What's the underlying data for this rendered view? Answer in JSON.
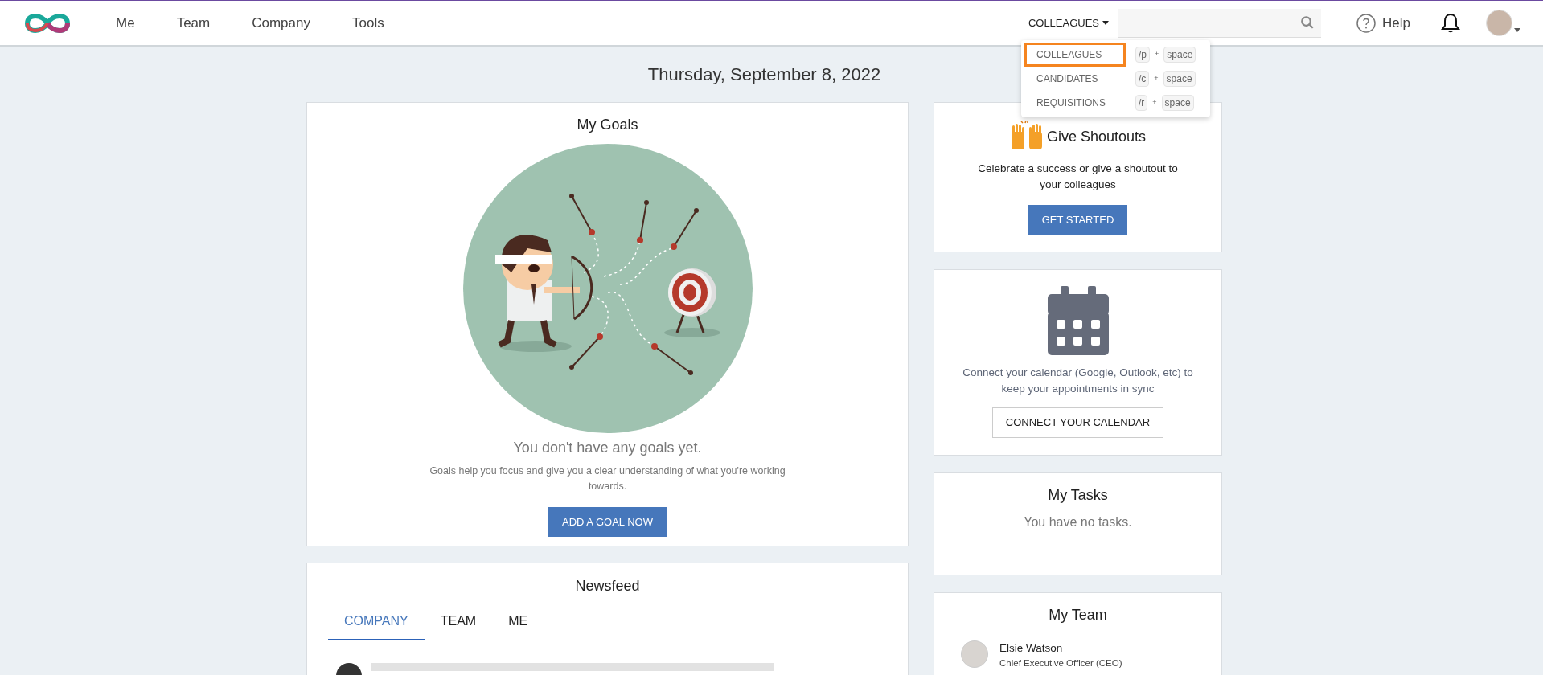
{
  "nav": {
    "links": [
      {
        "label": "Me"
      },
      {
        "label": "Team"
      },
      {
        "label": "Company"
      },
      {
        "label": "Tools"
      }
    ]
  },
  "search": {
    "scope": "COLLEAGUES",
    "menu_open": true,
    "scope_menu": [
      {
        "label": "COLLEAGUES",
        "shortcut": "/p",
        "plus": "+",
        "key": "space",
        "selected": true
      },
      {
        "label": "CANDIDATES",
        "shortcut": "/c",
        "plus": "+",
        "key": "space",
        "selected": false
      },
      {
        "label": "REQUISITIONS",
        "shortcut": "/r",
        "plus": "+",
        "key": "space",
        "selected": false
      }
    ]
  },
  "help": {
    "label": "Help"
  },
  "date": "Thursday, September 8, 2022",
  "goals": {
    "title": "My Goals",
    "empty_title": "You don't have any goals yet.",
    "description": "Goals help you focus and give you a clear understanding of what you're working towards.",
    "button": "ADD A GOAL NOW"
  },
  "newsfeed": {
    "title": "Newsfeed",
    "tabs": [
      {
        "label": "COMPANY",
        "selected": true
      },
      {
        "label": "TEAM",
        "selected": false
      },
      {
        "label": "ME",
        "selected": false
      }
    ]
  },
  "shoutouts": {
    "title": "Give Shoutouts",
    "description": "Celebrate a success or give a shoutout to your colleagues",
    "button": "GET STARTED"
  },
  "calendar": {
    "description": "Connect your calendar (Google, Outlook, etc) to keep your appointments in sync",
    "button": "CONNECT YOUR CALENDAR"
  },
  "tasks": {
    "title": "My Tasks",
    "empty": "You have no tasks."
  },
  "team": {
    "title": "My Team",
    "members": [
      {
        "name": "Elsie Watson",
        "role": "Chief Executive Officer (CEO)"
      }
    ]
  }
}
